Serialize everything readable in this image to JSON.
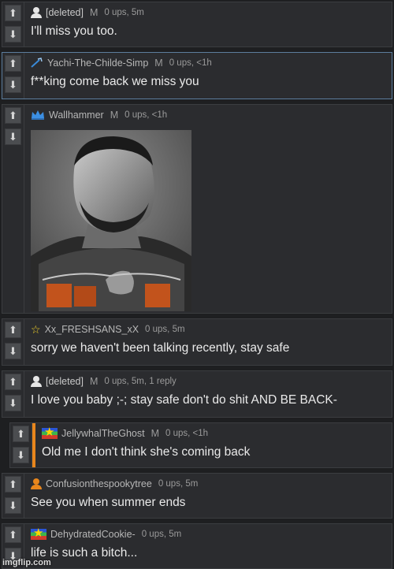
{
  "comments": [
    {
      "user": "[deleted]",
      "mod": "M",
      "meta": "0 ups, 5m",
      "text": "I'll miss you too.",
      "avatar": "person-icon"
    },
    {
      "user": "Yachi-The-Childe-Simp",
      "mod": "M",
      "meta": "0 ups, <1h",
      "text": "f**king come back we miss you",
      "avatar": "sword-icon"
    },
    {
      "user": "Wallhammer",
      "mod": "M",
      "meta": "0 ups, <1h",
      "text": "",
      "avatar": "crown-icon",
      "image": "gigachad-meme-image"
    },
    {
      "user": "Xx_FRESHSANS_xX",
      "meta": "0 ups, 5m",
      "text": "sorry we haven't been talking recently, stay safe",
      "avatar": "star-icon"
    },
    {
      "user": "[deleted]",
      "mod": "M",
      "meta": "0 ups, 5m, 1 reply",
      "text": "I love you baby ;-; stay safe don't do shit AND BE BACK-",
      "avatar": "person-icon"
    },
    {
      "user": "JellywhalTheGhost",
      "mod": "M",
      "meta": "0 ups, <1h",
      "text": "Old me I don't think she's coming back",
      "avatar": "flag-icon"
    },
    {
      "user": "Confusionthespookytree",
      "meta": "0 ups, 5m",
      "text": "See you when summer ends",
      "avatar": "orange-person-icon"
    },
    {
      "user": "DehydratedCookie-",
      "meta": "0 ups, 5m",
      "text": "life is such a bitch...",
      "avatar": "flag-icon"
    }
  ],
  "vote": {
    "up": "⬆",
    "down": "⬇"
  },
  "watermark": "imgflip.com",
  "colors": {
    "accent_orange": "#e8861c",
    "focus_border": "#5c7d9d"
  }
}
